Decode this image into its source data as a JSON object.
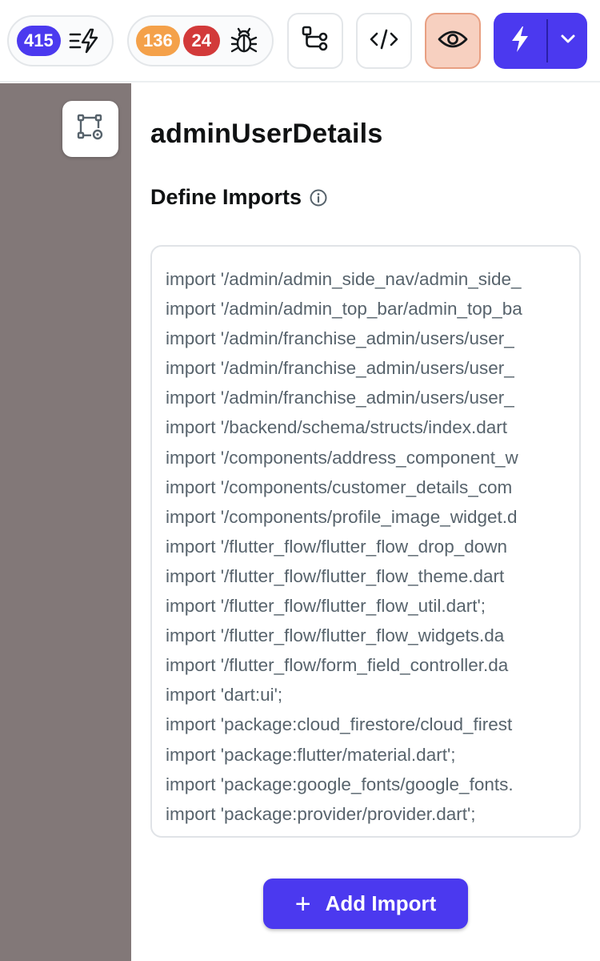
{
  "toolbar": {
    "error_count": "415",
    "warning_count": "136",
    "issue_count": "24",
    "icons": {
      "errors": "list-bolt-icon",
      "issues": "bug-icon",
      "flow": "flow-tree-icon",
      "code": "code-icon",
      "preview": "eye-icon",
      "run": "lightning-icon",
      "run_menu": "chevron-down-icon"
    },
    "colors": {
      "primary": "#4b39ef",
      "warning": "#f4a14a",
      "error": "#d23a3a",
      "preview_active_bg": "#f7d0c0"
    }
  },
  "rail": {
    "tool_icon": "custom-code-node-icon",
    "color": "#827878"
  },
  "panel": {
    "title": "adminUserDetails",
    "section_title": "Define Imports",
    "section_info_icon": "info-icon",
    "imports": [
      "import '/admin/admin_side_nav/admin_side_",
      "import '/admin/admin_top_bar/admin_top_ba",
      "import '/admin/franchise_admin/users/user_",
      "import '/admin/franchise_admin/users/user_",
      "import '/admin/franchise_admin/users/user_",
      "import '/backend/schema/structs/index.dart",
      "import '/components/address_component_w",
      "import '/components/customer_details_com",
      "import '/components/profile_image_widget.d",
      "import '/flutter_flow/flutter_flow_drop_down",
      "import '/flutter_flow/flutter_flow_theme.dart",
      "import '/flutter_flow/flutter_flow_util.dart';",
      "import '/flutter_flow/flutter_flow_widgets.da",
      "import '/flutter_flow/form_field_controller.da",
      "import 'dart:ui';",
      "import 'package:cloud_firestore/cloud_firest",
      "import 'package:flutter/material.dart';",
      "import 'package:google_fonts/google_fonts.",
      "import 'package:provider/provider.dart';"
    ],
    "add_button_label": "Add Import",
    "add_button_icon": "plus-icon"
  }
}
